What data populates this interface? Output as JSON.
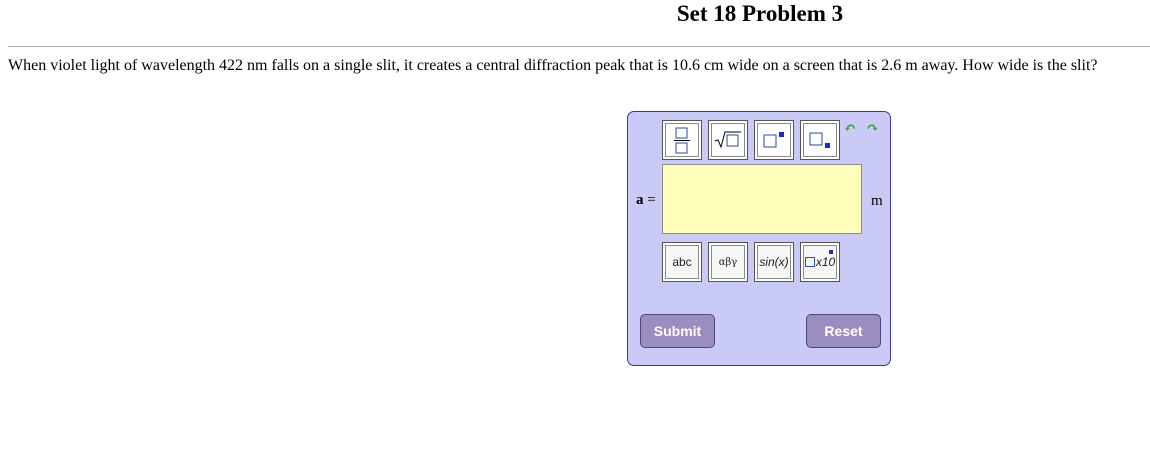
{
  "page": {
    "title": "Set 18 Problem 3",
    "question": "When violet light of wavelength 422 nm falls on a single slit, it creates a central diffraction peak that is 10.6 cm wide on a screen that is 2.6 m away. How wide is the slit?"
  },
  "answer": {
    "variable": "a",
    "equals": "=",
    "unit": "m",
    "value": ""
  },
  "toolbar": {
    "top_buttons": [
      "fraction",
      "square-root",
      "superscript",
      "subscript"
    ],
    "undo_icon": "undo-icon",
    "redo_icon": "redo-icon",
    "abc_label": "abc",
    "greek_label": "αβγ",
    "func_label": "sin(x)",
    "sci_label": "x10"
  },
  "actions": {
    "submit_label": "Submit",
    "reset_label": "Reset"
  },
  "colors": {
    "panel_bg": "#cacaf6",
    "input_bg": "#ffffbb",
    "button_bg": "#9a8ec0",
    "undo_green": "#3aa63a"
  }
}
